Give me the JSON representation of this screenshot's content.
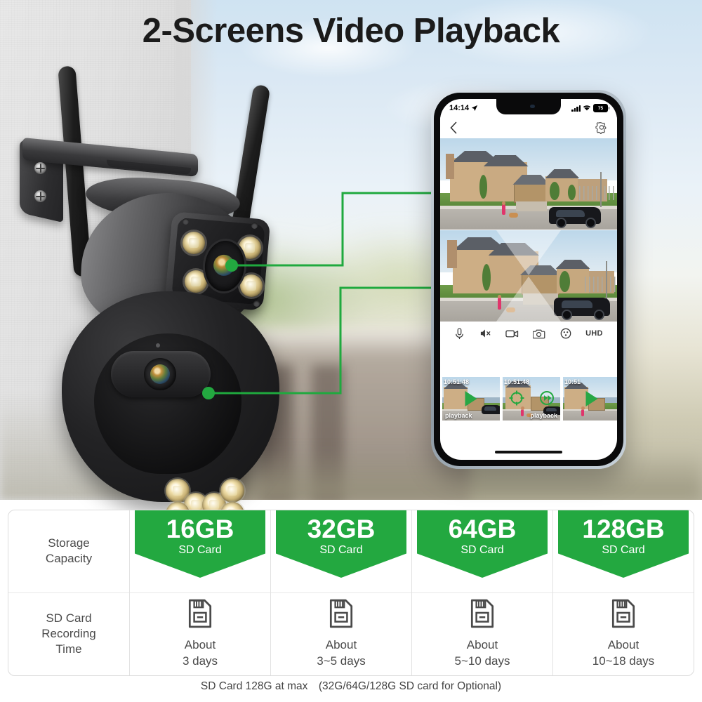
{
  "title": "2-Screens Video Playback",
  "phone": {
    "status_bar": {
      "time": "14:14",
      "location_icon": "location-arrow-icon",
      "signal_icon": "signal-bars-icon",
      "wifi_icon": "wifi-icon",
      "battery_level": "75"
    },
    "nav": {
      "back_icon": "chevron-left-icon",
      "settings_icon": "gear-icon"
    },
    "controls": [
      {
        "name": "microphone",
        "icon": "microphone-icon",
        "label": ""
      },
      {
        "name": "speaker-mute",
        "icon": "speaker-mute-icon",
        "label": ""
      },
      {
        "name": "record-video",
        "icon": "video-camera-icon",
        "label": ""
      },
      {
        "name": "snapshot",
        "icon": "camera-icon",
        "label": ""
      },
      {
        "name": "more-options",
        "icon": "smiley-dots-icon",
        "label": ""
      },
      {
        "name": "resolution",
        "icon": "text-label",
        "label": "UHD"
      }
    ],
    "thumbnails": [
      {
        "timestamp": "10:51:48",
        "label": "playback"
      },
      {
        "timestamp": "10:51:48",
        "label": "playback"
      },
      {
        "timestamp": "10:51",
        "label": ""
      }
    ]
  },
  "table": {
    "row_labels": [
      "Storage\nCapacity",
      "SD Card\nRecording\nTime"
    ],
    "row1_label_line1": "Storage",
    "row1_label_line2": "Capacity",
    "row2_label_line1": "SD Card",
    "row2_label_line2": "Recording",
    "row2_label_line3": "Time",
    "card_sub": "SD Card",
    "about_word": "About",
    "columns": [
      {
        "size": "16GB",
        "sub": "SD Card",
        "about": "About",
        "days": "3 days"
      },
      {
        "size": "32GB",
        "sub": "SD Card",
        "about": "About",
        "days": "3~5 days"
      },
      {
        "size": "64GB",
        "sub": "SD Card",
        "about": "About",
        "days": "5~10 days"
      },
      {
        "size": "128GB",
        "sub": "SD Card",
        "about": "About",
        "days": "10~18 days"
      }
    ]
  },
  "footnote": "SD Card 128G at max  (32G/64G/128G SD card for Optional)",
  "colors": {
    "accent_green": "#23a840",
    "connector_green": "#1fa93e",
    "title_text": "#1b1b1b",
    "table_text": "#4a4a4a"
  }
}
